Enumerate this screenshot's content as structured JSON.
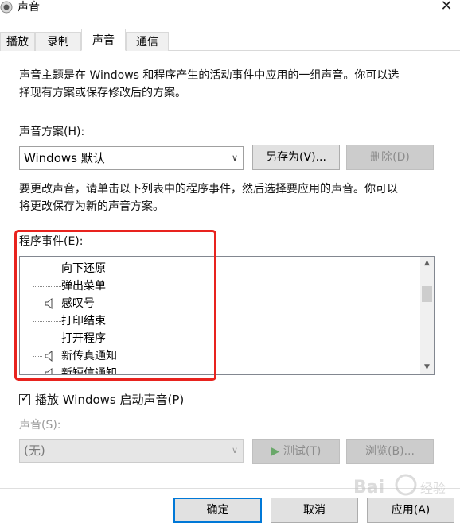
{
  "window": {
    "title": "声音",
    "close_icon": "close-icon"
  },
  "tabs": [
    {
      "label": "播放",
      "active": false
    },
    {
      "label": "录制",
      "active": false
    },
    {
      "label": "声音",
      "active": true
    },
    {
      "label": "通信",
      "active": false
    }
  ],
  "description": {
    "line1": "声音主题是在 Windows 和程序产生的活动事件中应用的一组声音。你可以选",
    "line2": "择现有方案或保存修改后的方案。"
  },
  "scheme": {
    "label": "声音方案(H):",
    "selected": "Windows 默认",
    "save_as": "另存为(V)...",
    "delete": "删除(D)"
  },
  "instruction": {
    "line1": "要更改声音，请单击以下列表中的程序事件，然后选择要应用的声音。你可以",
    "line2": "将更改保存为新的声音方案。"
  },
  "events": {
    "label": "程序事件(E):",
    "items": [
      {
        "label": "向下还原",
        "has_sound": false
      },
      {
        "label": "弹出菜单",
        "has_sound": false
      },
      {
        "label": "感叹号",
        "has_sound": true
      },
      {
        "label": "打印结束",
        "has_sound": false
      },
      {
        "label": "打开程序",
        "has_sound": false
      },
      {
        "label": "新传真通知",
        "has_sound": true
      },
      {
        "label": "新短信通知",
        "has_sound": true
      }
    ]
  },
  "startup_sound": {
    "label": "播放 Windows 启动声音(P)",
    "checked": true
  },
  "sound": {
    "label": "声音(S):",
    "selected": "(无)",
    "test": "测试(T)",
    "browse": "浏览(B)..."
  },
  "footer": {
    "ok": "确定",
    "cancel": "取消",
    "apply": "应用(A)"
  },
  "watermark": {
    "text": "Bai 经验"
  },
  "colors": {
    "highlight_frame": "#e8231e",
    "accent": "#0078d7",
    "test_icon": "#2ea44f"
  }
}
